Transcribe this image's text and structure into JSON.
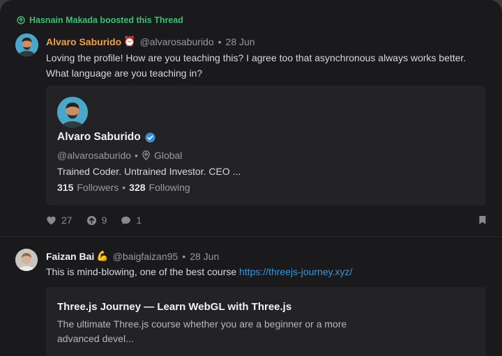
{
  "boost": {
    "text": "Hasnain Makada boosted this Thread",
    "icon": "boost-up-icon"
  },
  "post1": {
    "author": "Alvaro Saburido",
    "author_emoji": "⏰",
    "handle": "@alvarosaburido",
    "dot": "•",
    "date": "28 Jun",
    "line1": "Loving the profile! How are you teaching this? I agree too that asynchronous always works better.",
    "line2": "What language are you teaching in?",
    "card": {
      "name": "Alvaro Saburido",
      "handle": "@alvarosaburido",
      "dot": "•",
      "location": "Global",
      "bio": "Trained Coder. Untrained Investor. CEO ...",
      "followers_count": "315",
      "followers_label": "Followers",
      "following_count": "328",
      "following_label": "Following"
    },
    "actions": {
      "likes": "27",
      "boosts": "9",
      "comments": "1"
    }
  },
  "post2": {
    "author": "Faizan Bai",
    "author_emoji": "💪",
    "handle": "@baigfaizan95",
    "dot": "•",
    "date": "28 Jun",
    "text": "This is mind-blowing, one of the best course ",
    "link": "https://threejs-journey.xyz/",
    "preview": {
      "title": "Three.js Journey — Learn WebGL with Three.js",
      "desc": "The ultimate Three.js course whether you are a beginner or a more advanced devel..."
    }
  },
  "colors": {
    "boost": "#3fbf72",
    "author1": "#f0a04b",
    "link": "#3b95d6",
    "verified": "#3b8fd9"
  }
}
